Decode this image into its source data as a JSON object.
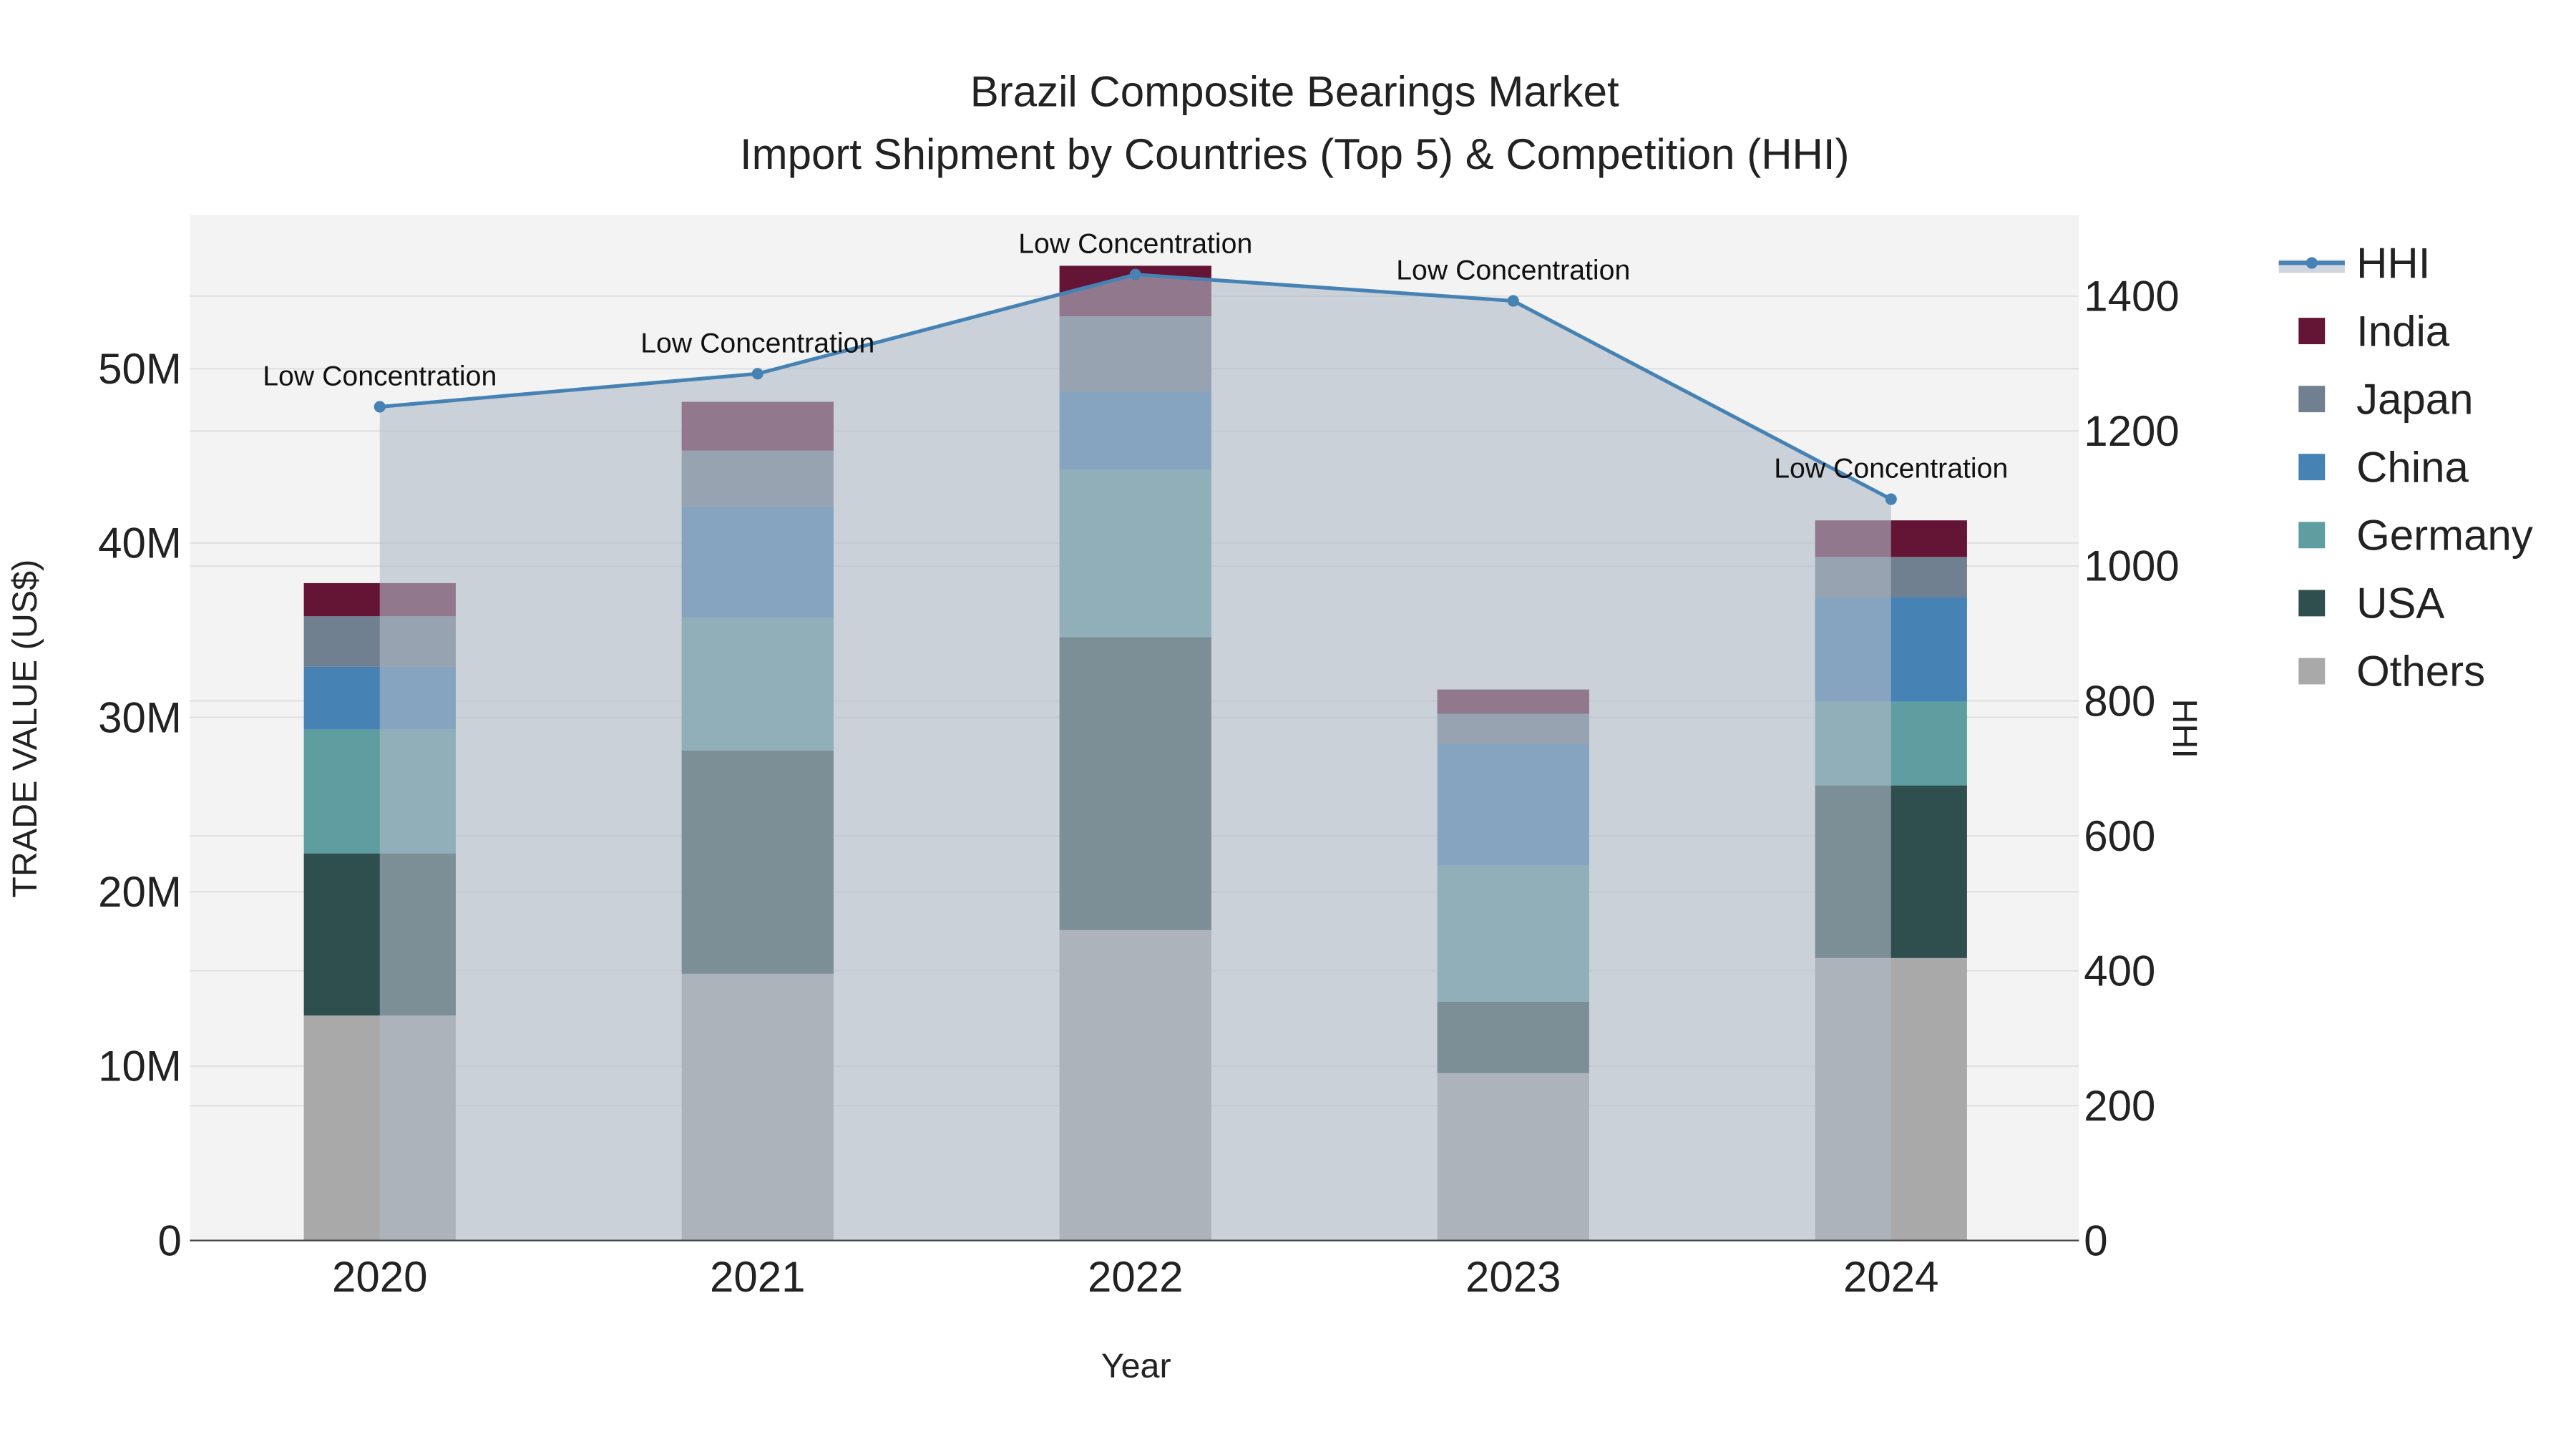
{
  "chart_data": {
    "type": "bar",
    "title": "Brazil Composite Bearings Market",
    "subtitle": "Import Shipment by Countries (Top 5) & Competition (HHI)",
    "xlabel": "Year",
    "ylabel": "TRADE VALUE (US$)",
    "y2label": "HHI",
    "categories": [
      "2020",
      "2021",
      "2022",
      "2023",
      "2024"
    ],
    "ylim": [
      0,
      58000000
    ],
    "y2lim": [
      0,
      1515
    ],
    "yticks": [
      0,
      10000000,
      20000000,
      30000000,
      40000000,
      50000000
    ],
    "ytick_labels": [
      "0",
      "10M",
      "20M",
      "30M",
      "40M",
      "50M"
    ],
    "y2ticks": [
      0,
      200,
      400,
      600,
      800,
      1000,
      1200,
      1400
    ],
    "y2tick_labels": [
      "0",
      "200",
      "400",
      "600",
      "800",
      "1000",
      "1200",
      "1400"
    ],
    "grid": true,
    "legend_placement": "right",
    "series": [
      {
        "name": "Others",
        "color": "#a9a9a9",
        "values": [
          12900000,
          15300000,
          17800000,
          9600000,
          16200000
        ]
      },
      {
        "name": "USA",
        "color": "#2f4f4f",
        "values": [
          9300000,
          12800000,
          16800000,
          4100000,
          9900000
        ]
      },
      {
        "name": "Germany",
        "color": "#5f9ea0",
        "values": [
          7100000,
          7600000,
          9600000,
          7800000,
          4800000
        ]
      },
      {
        "name": "China",
        "color": "#4682b4",
        "values": [
          3600000,
          6400000,
          4500000,
          7000000,
          6000000
        ]
      },
      {
        "name": "Japan",
        "color": "#708090",
        "values": [
          2900000,
          3200000,
          4300000,
          1700000,
          2300000
        ]
      },
      {
        "name": "India",
        "color": "#641535",
        "values": [
          1900000,
          2800000,
          2900000,
          1400000,
          2100000
        ]
      }
    ],
    "hhi": {
      "name": "HHI",
      "color": "#4682b4",
      "values": [
        1236,
        1285,
        1432,
        1393,
        1099
      ],
      "annotations": [
        "Low Concentration",
        "Low Concentration",
        "Low Concentration",
        "Low Concentration",
        "Low Concentration"
      ]
    },
    "legend_order": [
      "HHI",
      "India",
      "Japan",
      "China",
      "Germany",
      "USA",
      "Others"
    ]
  }
}
